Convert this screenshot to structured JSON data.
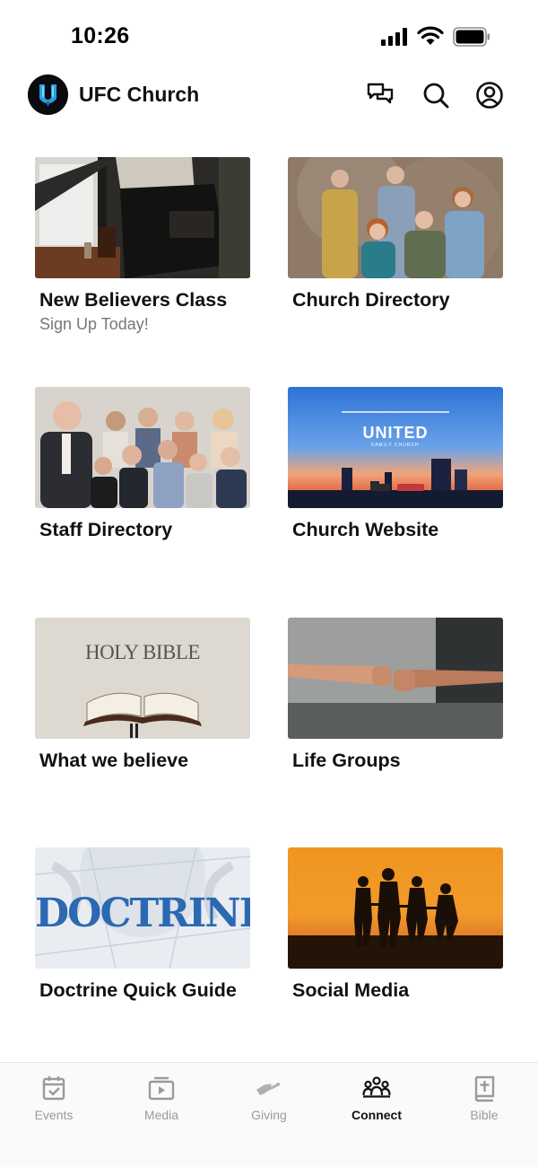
{
  "status_bar": {
    "time": "10:26"
  },
  "header": {
    "title": "UFC Church"
  },
  "cards": [
    {
      "title": "New Believers Class",
      "subtitle": "Sign Up Today!"
    },
    {
      "title": "Church Directory"
    },
    {
      "title": "Staff Directory"
    },
    {
      "title": "Church Website",
      "image_text": "UNITED",
      "image_subtext": "FAMILY CHURCH"
    },
    {
      "title": "What we believe",
      "image_text": "HOLY BIBLE"
    },
    {
      "title": "Life Groups"
    },
    {
      "title": "Doctrine Quick Guide",
      "image_text": "DOCTRINE"
    },
    {
      "title": "Social Media"
    }
  ],
  "tabs": [
    {
      "label": "Events",
      "icon": "calendar-check-icon",
      "active": false
    },
    {
      "label": "Media",
      "icon": "play-stack-icon",
      "active": false
    },
    {
      "label": "Giving",
      "icon": "hand-giving-icon",
      "active": false
    },
    {
      "label": "Connect",
      "icon": "people-group-icon",
      "active": true
    },
    {
      "label": "Bible",
      "icon": "bible-cross-icon",
      "active": false
    }
  ],
  "colors": {
    "active_tab": "#111111",
    "inactive_tab": "#9a9a9a",
    "tabbar_bg": "#fafafa"
  }
}
